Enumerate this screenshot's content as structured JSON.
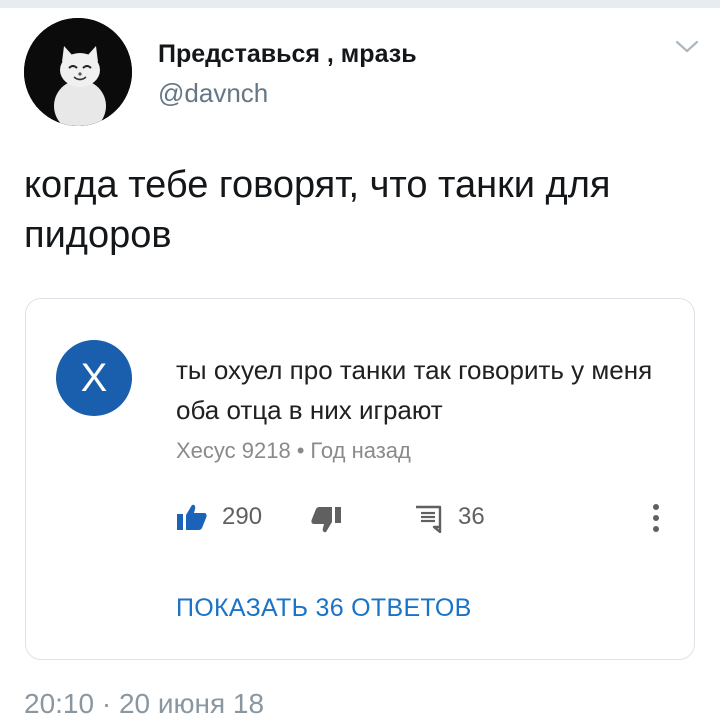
{
  "tweet": {
    "author": {
      "display_name": "Представься , мразь",
      "handle": "@davnch",
      "avatar_icon": "cat-avatar"
    },
    "menu_icon": "chevron-down-icon",
    "text": "когда тебе говорят, что танки для пидоров",
    "timestamp": "20:10 · 20 июня 18"
  },
  "embedded_comment": {
    "avatar_letter": "X",
    "avatar_color": "#1a5fad",
    "text": "ты охуел про танки так говорить у меня оба отца в них играют",
    "author": "Хесус 9218",
    "separator": "•",
    "time_ago": "Год назад",
    "likes": "290",
    "replies": "36",
    "show_replies_label": "ПОКАЗАТЬ 36 ОТВЕТОВ",
    "link_color": "#1a73c7"
  }
}
